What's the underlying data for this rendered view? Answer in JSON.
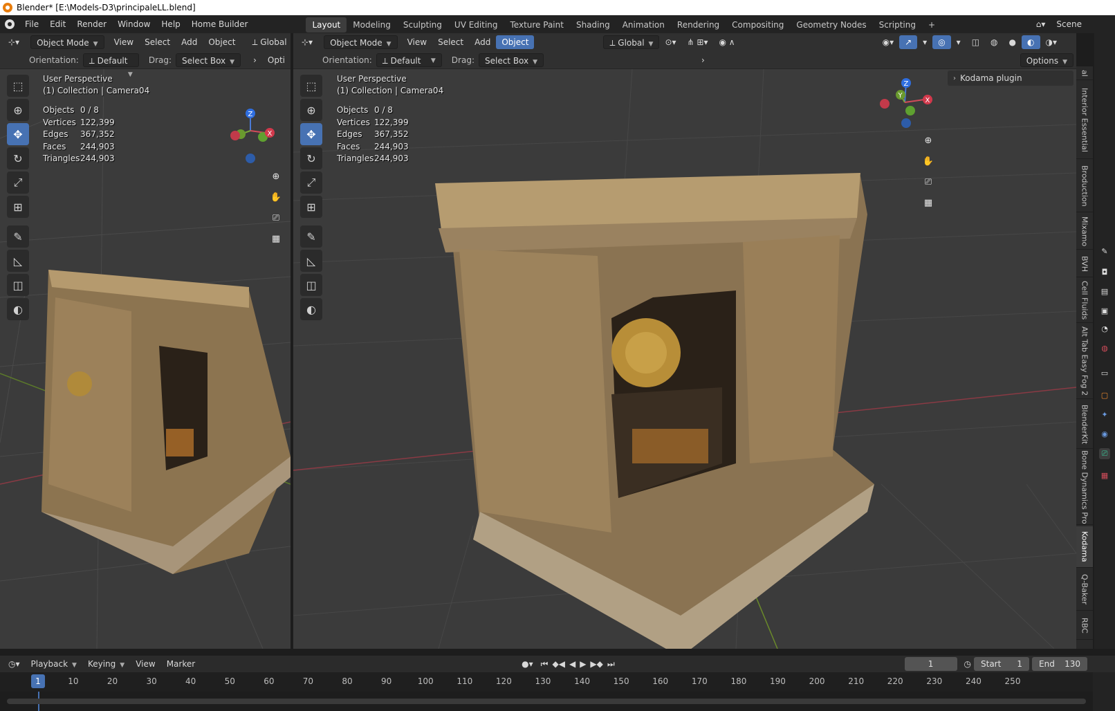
{
  "window": {
    "title": "Blender* [E:\\Models-D3\\principaleLL.blend]"
  },
  "menu": {
    "items": [
      "File",
      "Edit",
      "Render",
      "Window",
      "Help",
      "Home Builder"
    ],
    "workspaces": [
      "Layout",
      "Modeling",
      "Sculpting",
      "UV Editing",
      "Texture Paint",
      "Shading",
      "Animation",
      "Rendering",
      "Compositing",
      "Geometry Nodes",
      "Scripting"
    ],
    "add_tab": "+",
    "scene": "Scene"
  },
  "left_view": {
    "mode": "Object Mode",
    "menus": [
      "View",
      "Select",
      "Add",
      "Object"
    ],
    "transform": "Global",
    "orientation_label": "Orientation:",
    "orientation_value": "Default",
    "drag_label": "Drag:",
    "drag_value": "Select Box",
    "options_clip": "Opti",
    "perspective": "User Perspective",
    "collection": "(1) Collection | Camera04",
    "stats": [
      {
        "k": "Objects",
        "v": "0 / 8"
      },
      {
        "k": "Vertices",
        "v": "122,399"
      },
      {
        "k": "Edges",
        "v": "367,352"
      },
      {
        "k": "Faces",
        "v": "244,903"
      },
      {
        "k": "Triangles",
        "v": "244,903"
      }
    ]
  },
  "right_view": {
    "mode": "Object Mode",
    "menus": [
      "View",
      "Select",
      "Add",
      "Object"
    ],
    "transform": "Global",
    "orientation_label": "Orientation:",
    "orientation_value": "Default",
    "drag_label": "Drag:",
    "drag_value": "Select Box",
    "options": "Options",
    "perspective": "User Perspective",
    "collection": "(1) Collection | Camera04",
    "stats": [
      {
        "k": "Objects",
        "v": "0 / 8"
      },
      {
        "k": "Vertices",
        "v": "122,399"
      },
      {
        "k": "Edges",
        "v": "367,352"
      },
      {
        "k": "Faces",
        "v": "244,903"
      },
      {
        "k": "Triangles",
        "v": "244,903"
      }
    ],
    "panel": "Kodama plugin"
  },
  "gizmo": {
    "z": "Z",
    "y": "Y",
    "x": "X"
  },
  "sidebar_tabs": [
    "al",
    "Interior Essential",
    "Broduction",
    "Mixamo",
    "BVH",
    "Cell Fluids",
    "Alt Tab Easy Fog 2",
    "BlenderKit",
    "Bone Dynamics Pro",
    "Kodama",
    "Q-Baker",
    "RBC"
  ],
  "timeline": {
    "menus": [
      "Playback",
      "Keying",
      "View",
      "Marker"
    ],
    "current_frame": "1",
    "start_label": "Start",
    "start": "1",
    "end_label": "End",
    "end": "130",
    "ticks": [
      "1",
      "10",
      "20",
      "30",
      "40",
      "50",
      "60",
      "70",
      "80",
      "90",
      "100",
      "110",
      "120",
      "130",
      "140",
      "150",
      "160",
      "170",
      "180",
      "190",
      "200",
      "210",
      "220",
      "230",
      "240",
      "250"
    ]
  }
}
